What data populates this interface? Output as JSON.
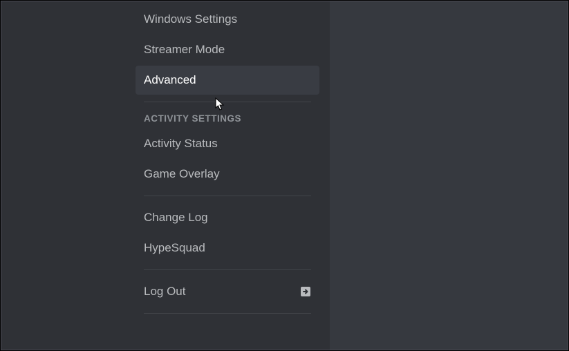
{
  "sidebar": {
    "top_items": [
      {
        "label": "Windows Settings"
      },
      {
        "label": "Streamer Mode"
      },
      {
        "label": "Advanced"
      }
    ],
    "activity_header": "ACTIVITY SETTINGS",
    "activity_items": [
      {
        "label": "Activity Status"
      },
      {
        "label": "Game Overlay"
      }
    ],
    "misc_items": [
      {
        "label": "Change Log"
      },
      {
        "label": "HypeSquad"
      }
    ],
    "logout_label": "Log Out"
  }
}
